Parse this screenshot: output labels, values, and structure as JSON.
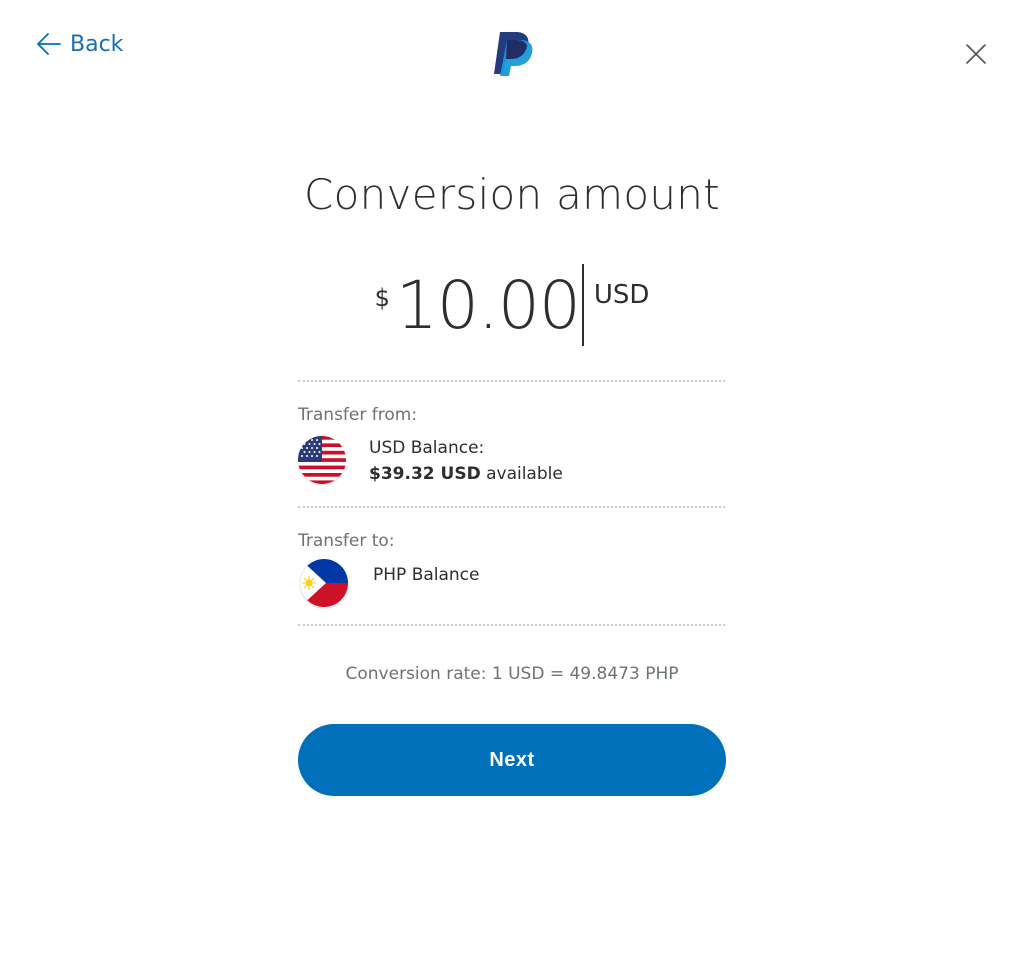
{
  "header": {
    "back_label": "Back",
    "back_icon": "arrow-left-icon",
    "logo_icon": "paypal-logo",
    "close_icon": "close-icon"
  },
  "title": "Conversion amount",
  "amount": {
    "symbol": "$",
    "value": "10.00",
    "currency": "USD"
  },
  "transfer_from": {
    "label": "Transfer from:",
    "account_name": "USD Balance:",
    "available_amount": "$39.32 USD",
    "available_suffix": " available",
    "flag_icon": "us-flag-icon"
  },
  "transfer_to": {
    "label": "Transfer to:",
    "account_name": "PHP Balance",
    "flag_icon": "philippines-flag-icon"
  },
  "conversion_rate": "Conversion rate: 1 USD = 49.8473 PHP",
  "next_label": "Next",
  "colors": {
    "brand_blue": "#0070ba",
    "text_dark": "#2c2e2f",
    "text_muted": "#6c7378"
  }
}
